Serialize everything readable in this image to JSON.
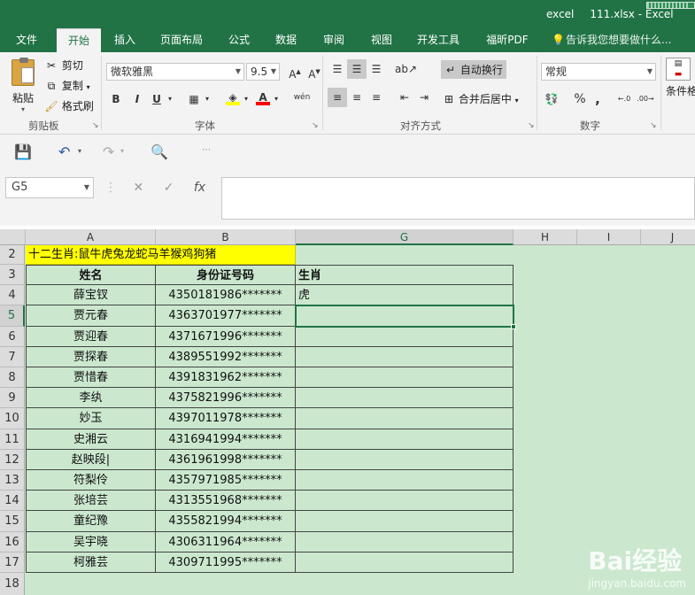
{
  "titlebar": {
    "app": "excel",
    "filename": "111.xlsx - Excel"
  },
  "tabs": [
    "文件",
    "开始",
    "插入",
    "页面布局",
    "公式",
    "数据",
    "审阅",
    "视图",
    "开发工具",
    "福昕PDF"
  ],
  "tell_me": "告诉我您想要做什么...",
  "ribbon": {
    "clipboard": {
      "paste": "粘贴",
      "cut": "剪切",
      "copy": "复制",
      "format_painter": "格式刷",
      "label": "剪贴板"
    },
    "font": {
      "name": "微软雅黑",
      "size": "9.5",
      "label": "字体",
      "bold": "B",
      "italic": "I",
      "underline": "U",
      "wen": "wén"
    },
    "alignment": {
      "wrap": "自动换行",
      "merge": "合并后居中",
      "label": "对齐方式"
    },
    "number": {
      "format": "常规",
      "label": "数字",
      "percent": "%"
    },
    "styles": {
      "conditional": "条件格"
    }
  },
  "formula_bar": {
    "name_box": "G5",
    "fx": "fx",
    "formula": ""
  },
  "columns": [
    "A",
    "B",
    "G",
    "H",
    "I",
    "J"
  ],
  "rows": [
    "2",
    "3",
    "4",
    "5",
    "6",
    "7",
    "8",
    "9",
    "10",
    "11",
    "12",
    "13",
    "14",
    "15",
    "16",
    "17",
    "18"
  ],
  "sheet": {
    "a2": "十二生肖:鼠牛虎兔龙蛇马羊猴鸡狗猪",
    "header": {
      "name": "姓名",
      "id": "身份证号码",
      "zodiac": "生肖"
    },
    "records": [
      {
        "name": "薛宝钗",
        "id": "4350181986*******",
        "zodiac": "虎"
      },
      {
        "name": "贾元春",
        "id": "4363701977*******",
        "zodiac": ""
      },
      {
        "name": "贾迎春",
        "id": "4371671996*******",
        "zodiac": ""
      },
      {
        "name": "贾探春",
        "id": "4389551992*******",
        "zodiac": ""
      },
      {
        "name": "贾惜春",
        "id": "4391831962*******",
        "zodiac": ""
      },
      {
        "name": "李纨",
        "id": "4375821996*******",
        "zodiac": ""
      },
      {
        "name": "妙玉",
        "id": "4397011978*******",
        "zodiac": ""
      },
      {
        "name": "史湘云",
        "id": "4316941994*******",
        "zodiac": ""
      },
      {
        "name": "赵映段|",
        "id": "4361961998*******",
        "zodiac": ""
      },
      {
        "name": "符梨伶",
        "id": "4357971985*******",
        "zodiac": ""
      },
      {
        "name": "张培芸",
        "id": "4313551968*******",
        "zodiac": ""
      },
      {
        "name": "童纪豫",
        "id": "4355821994*******",
        "zodiac": ""
      },
      {
        "name": "吴宇晓",
        "id": "4306311964*******",
        "zodiac": ""
      },
      {
        "name": "柯雅芸",
        "id": "4309711995*******",
        "zodiac": ""
      }
    ]
  },
  "watermark": {
    "brand": "Bai经验",
    "url": "jingyan.baidu.com"
  }
}
